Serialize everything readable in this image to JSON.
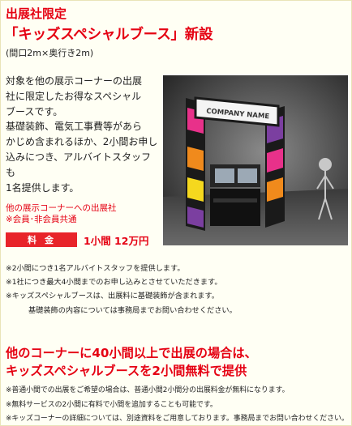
{
  "header": {
    "eyebrow": "出展社限定",
    "title": "「キッズスペシャルブース」新設",
    "size_note": "(間口2m×奥行き2m)"
  },
  "description": {
    "lines": [
      "対象を他の展示コーナーの出展",
      "社に限定したお得なスペシャル",
      "ブースです。",
      "基礎装飾、電気工事費等があら",
      "かじめ含まれるほか、2小間お申し",
      "込みにつき、アルバイトスタッフも",
      "1名提供します。"
    ]
  },
  "booth_image": {
    "sign_text": "COMPANY NAME",
    "colors": {
      "frame": "#1a1a1a",
      "pink": "#e8318a",
      "orange": "#f08a1c",
      "yellow": "#f5d81e",
      "purple": "#7b3fa0",
      "sky": "#5a5a5a"
    }
  },
  "target": {
    "line1": "他の展示コーナーへの出展社",
    "line2": "※会員･非会員共通"
  },
  "price": {
    "label": "料金",
    "value": "1小間 12万円"
  },
  "notes": {
    "items": [
      "※2小間につき1名アルバイトスタッフを提供します。",
      "※1社につき最大4小間までのお申し込みとさせていただきます。",
      "※キッズスペシャルブースは、出展料に基礎装飾が含まれます。",
      "基礎装飾の内容については事務局までお問い合わせください。"
    ]
  },
  "promo": {
    "line1": "他のコーナーに40小間以上で出展の場合は、",
    "line2": "キッズスペシャルブースを2小間無料で提供"
  },
  "notes2": {
    "items": [
      "※普通小間での出展をご希望の場合は、普通小間2小間分の出展料金が無料になります。",
      "※無料サービスの2小間に有料で小間を追加することも可能です。",
      "※キッズコーナーの詳細については、別途資料をご用意しております。事務局までお問い合わせください。"
    ]
  }
}
